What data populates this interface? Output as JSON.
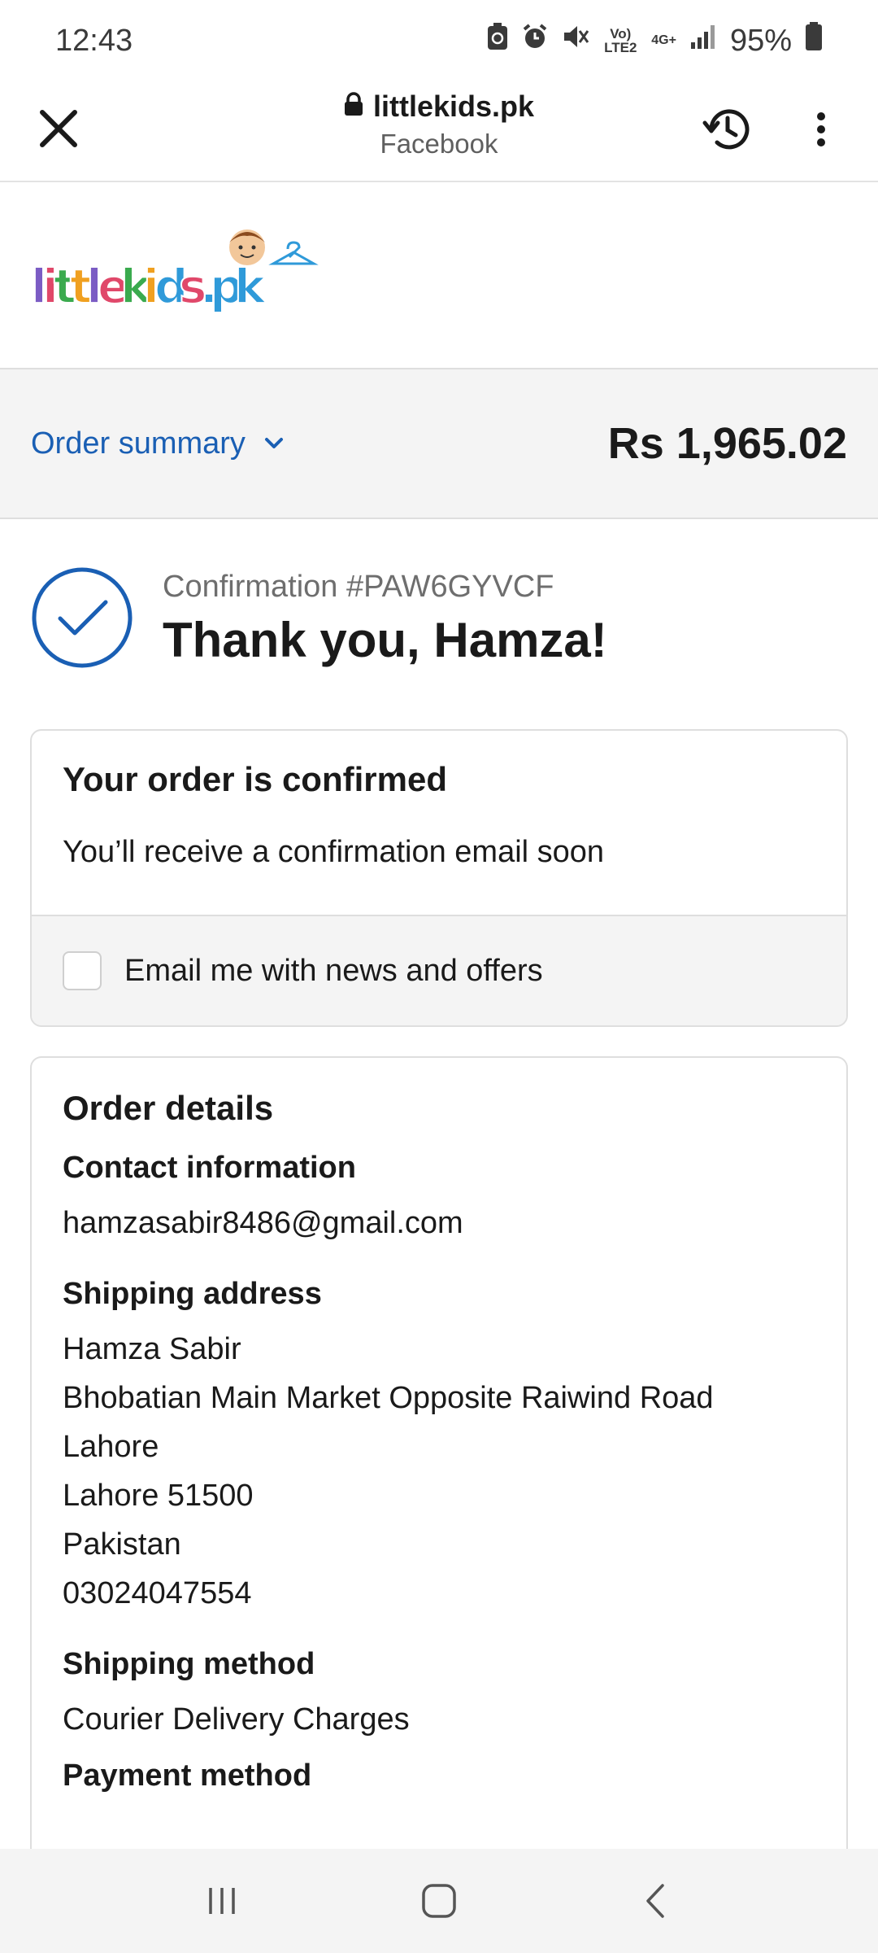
{
  "status_bar": {
    "time": "12:43",
    "battery": "95%",
    "network_label": "Vo) LTE2",
    "data_label": "4G+"
  },
  "browser": {
    "domain": "littlekids.pk",
    "source": "Facebook",
    "icons": [
      "close-icon",
      "lock-icon",
      "history-icon",
      "more-vert-icon"
    ]
  },
  "logo": {
    "text_parts": [
      "l",
      "i",
      "t",
      "t",
      "l",
      "e",
      "k",
      "i",
      "d",
      "s",
      ".",
      "p",
      "k"
    ],
    "colors": [
      "#7b5cc4",
      "#e0486a",
      "#3aaa4e",
      "#f0a020",
      "#7b5cc4",
      "#e0486a",
      "#3aaa4e",
      "#f0a020",
      "#2f9ad9",
      "#e0486a",
      "#2f9ad9",
      "#2f9ad9",
      "#2f9ad9"
    ]
  },
  "order_summary": {
    "label": "Order summary",
    "total": "Rs 1,965.02"
  },
  "confirmation": {
    "number": "Confirmation #PAW6GYVCF",
    "title": "Thank you, Hamza!"
  },
  "confirm_card": {
    "heading": "Your order is confirmed",
    "text": "You’ll receive a confirmation email soon",
    "newsletter_label": "Email me with news and offers"
  },
  "order_details": {
    "heading": "Order details",
    "contact": {
      "title": "Contact information",
      "email": "hamzasabir8486@gmail.com"
    },
    "shipping_address": {
      "title": "Shipping address",
      "lines": [
        "Hamza Sabir",
        "Bhobatian Main Market Opposite Raiwind Road",
        "Lahore",
        "Lahore 51500",
        "Pakistan",
        "03024047554"
      ]
    },
    "shipping_method": {
      "title": "Shipping method",
      "value": "Courier Delivery Charges"
    },
    "payment_method": {
      "title": "Payment method"
    }
  },
  "colors": {
    "accent": "#1a5fb4",
    "panel_bg": "#f4f4f4",
    "border": "#dedede"
  }
}
